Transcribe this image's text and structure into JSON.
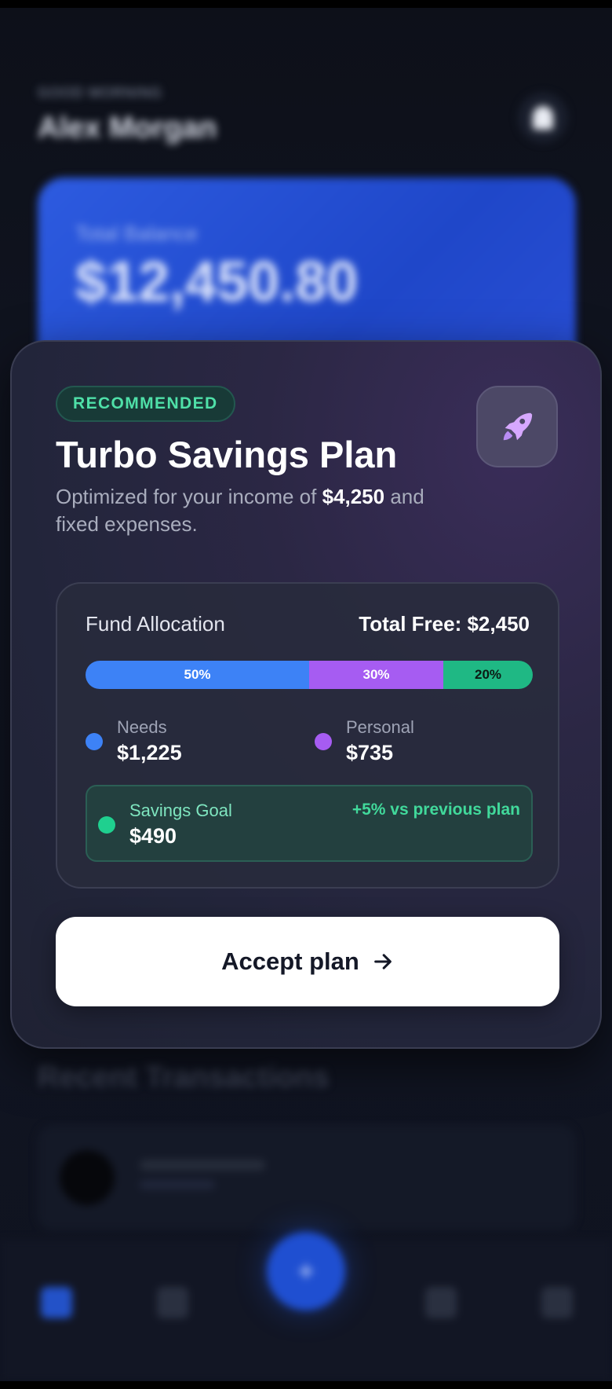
{
  "background": {
    "greeting": "GOOD MORNING",
    "user_name": "Alex Morgan",
    "balance_label": "Total Balance",
    "balance_value": "$12,450.80",
    "recent_title": "Recent Transactions"
  },
  "plan": {
    "badge": "RECOMMENDED",
    "title": "Turbo Savings Plan",
    "desc_prefix": "Optimized for your income of ",
    "income": "$4,250",
    "desc_suffix": " and fixed expenses.",
    "icon": "rocket-icon"
  },
  "allocation": {
    "title": "Fund Allocation",
    "total": "Total Free: $2,450",
    "segments": [
      {
        "name": "Needs",
        "pct_label": "50%",
        "color": "#3d82f6"
      },
      {
        "name": "Personal",
        "pct_label": "30%",
        "color": "#a65cf2"
      },
      {
        "name": "Savings Goal",
        "pct_label": "20%",
        "color": "#1fb884"
      }
    ],
    "needs": {
      "label": "Needs",
      "value": "$1,225"
    },
    "personal": {
      "label": "Personal",
      "value": "$735"
    },
    "savings": {
      "label": "Savings Goal",
      "value": "$490",
      "delta": "+5% vs previous plan"
    }
  },
  "actions": {
    "accept_label": "Accept plan"
  },
  "nav": {
    "fab_label": "+"
  },
  "colors": {
    "accent_green": "#41d99b",
    "accent_purple": "#a65cf2",
    "accent_blue": "#3d82f6"
  }
}
